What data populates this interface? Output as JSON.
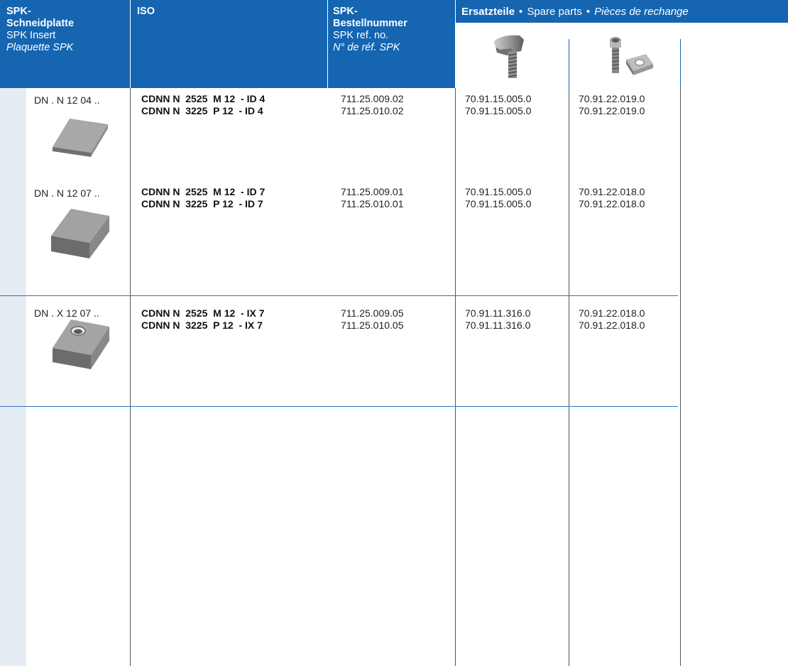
{
  "header": {
    "col1": {
      "line1": "SPK-",
      "line2": "Schneidplatte",
      "line3": "SPK Insert",
      "line4": "Plaquette SPK"
    },
    "col2": {
      "line1": "ISO"
    },
    "col3": {
      "line1": "SPK-",
      "line2": "Bestellnummer",
      "line3": "SPK ref. no.",
      "line4": "N° de réf. SPK"
    },
    "spare": {
      "de": "Ersatzteile",
      "en": "Spare parts",
      "fr": "Pièces de rechange",
      "separator": "•"
    },
    "spare_icons": [
      "clamp-icon",
      "screw-and-shim-icon"
    ]
  },
  "rows": [
    {
      "code": "DN . N  12 04 ..",
      "iso": [
        "CDNN N  2525  M 12  - ID 4",
        "CDNN N  3225  P 12  - ID 4"
      ],
      "ref": [
        "711.25.009.02",
        "711.25.010.02"
      ],
      "spare1": [
        "70.91.15.005.0",
        "70.91.15.005.0"
      ],
      "spare2": [
        "70.91.22.019.0",
        "70.91.22.019.0"
      ],
      "insert_icon": "insert-thin-icon"
    },
    {
      "code": "DN . N  12 07 ..",
      "iso": [
        "CDNN N  2525  M 12  - ID 7",
        "CDNN N  3225  P 12  - ID 7"
      ],
      "ref": [
        "711.25.009.01",
        "711.25.010.01"
      ],
      "spare1": [
        "70.91.15.005.0",
        "70.91.15.005.0"
      ],
      "spare2": [
        "70.91.22.018.0",
        "70.91.22.018.0"
      ],
      "insert_icon": "insert-thick-icon"
    },
    {
      "code": "DN . X  12 07 ..",
      "iso": [
        "CDNN N  2525  M 12  - IX 7",
        "CDNN N  3225  P 12  - IX 7"
      ],
      "ref": [
        "711.25.009.05",
        "711.25.010.05"
      ],
      "spare1": [
        "70.91.11.316.0",
        "70.91.11.316.0"
      ],
      "spare2": [
        "70.91.22.018.0",
        "70.91.22.018.0"
      ],
      "insert_icon": "insert-with-hole-icon"
    }
  ],
  "colors": {
    "header_bg": "#1565b0",
    "band": "#e6ecf4",
    "rule": "#2b74bd"
  }
}
